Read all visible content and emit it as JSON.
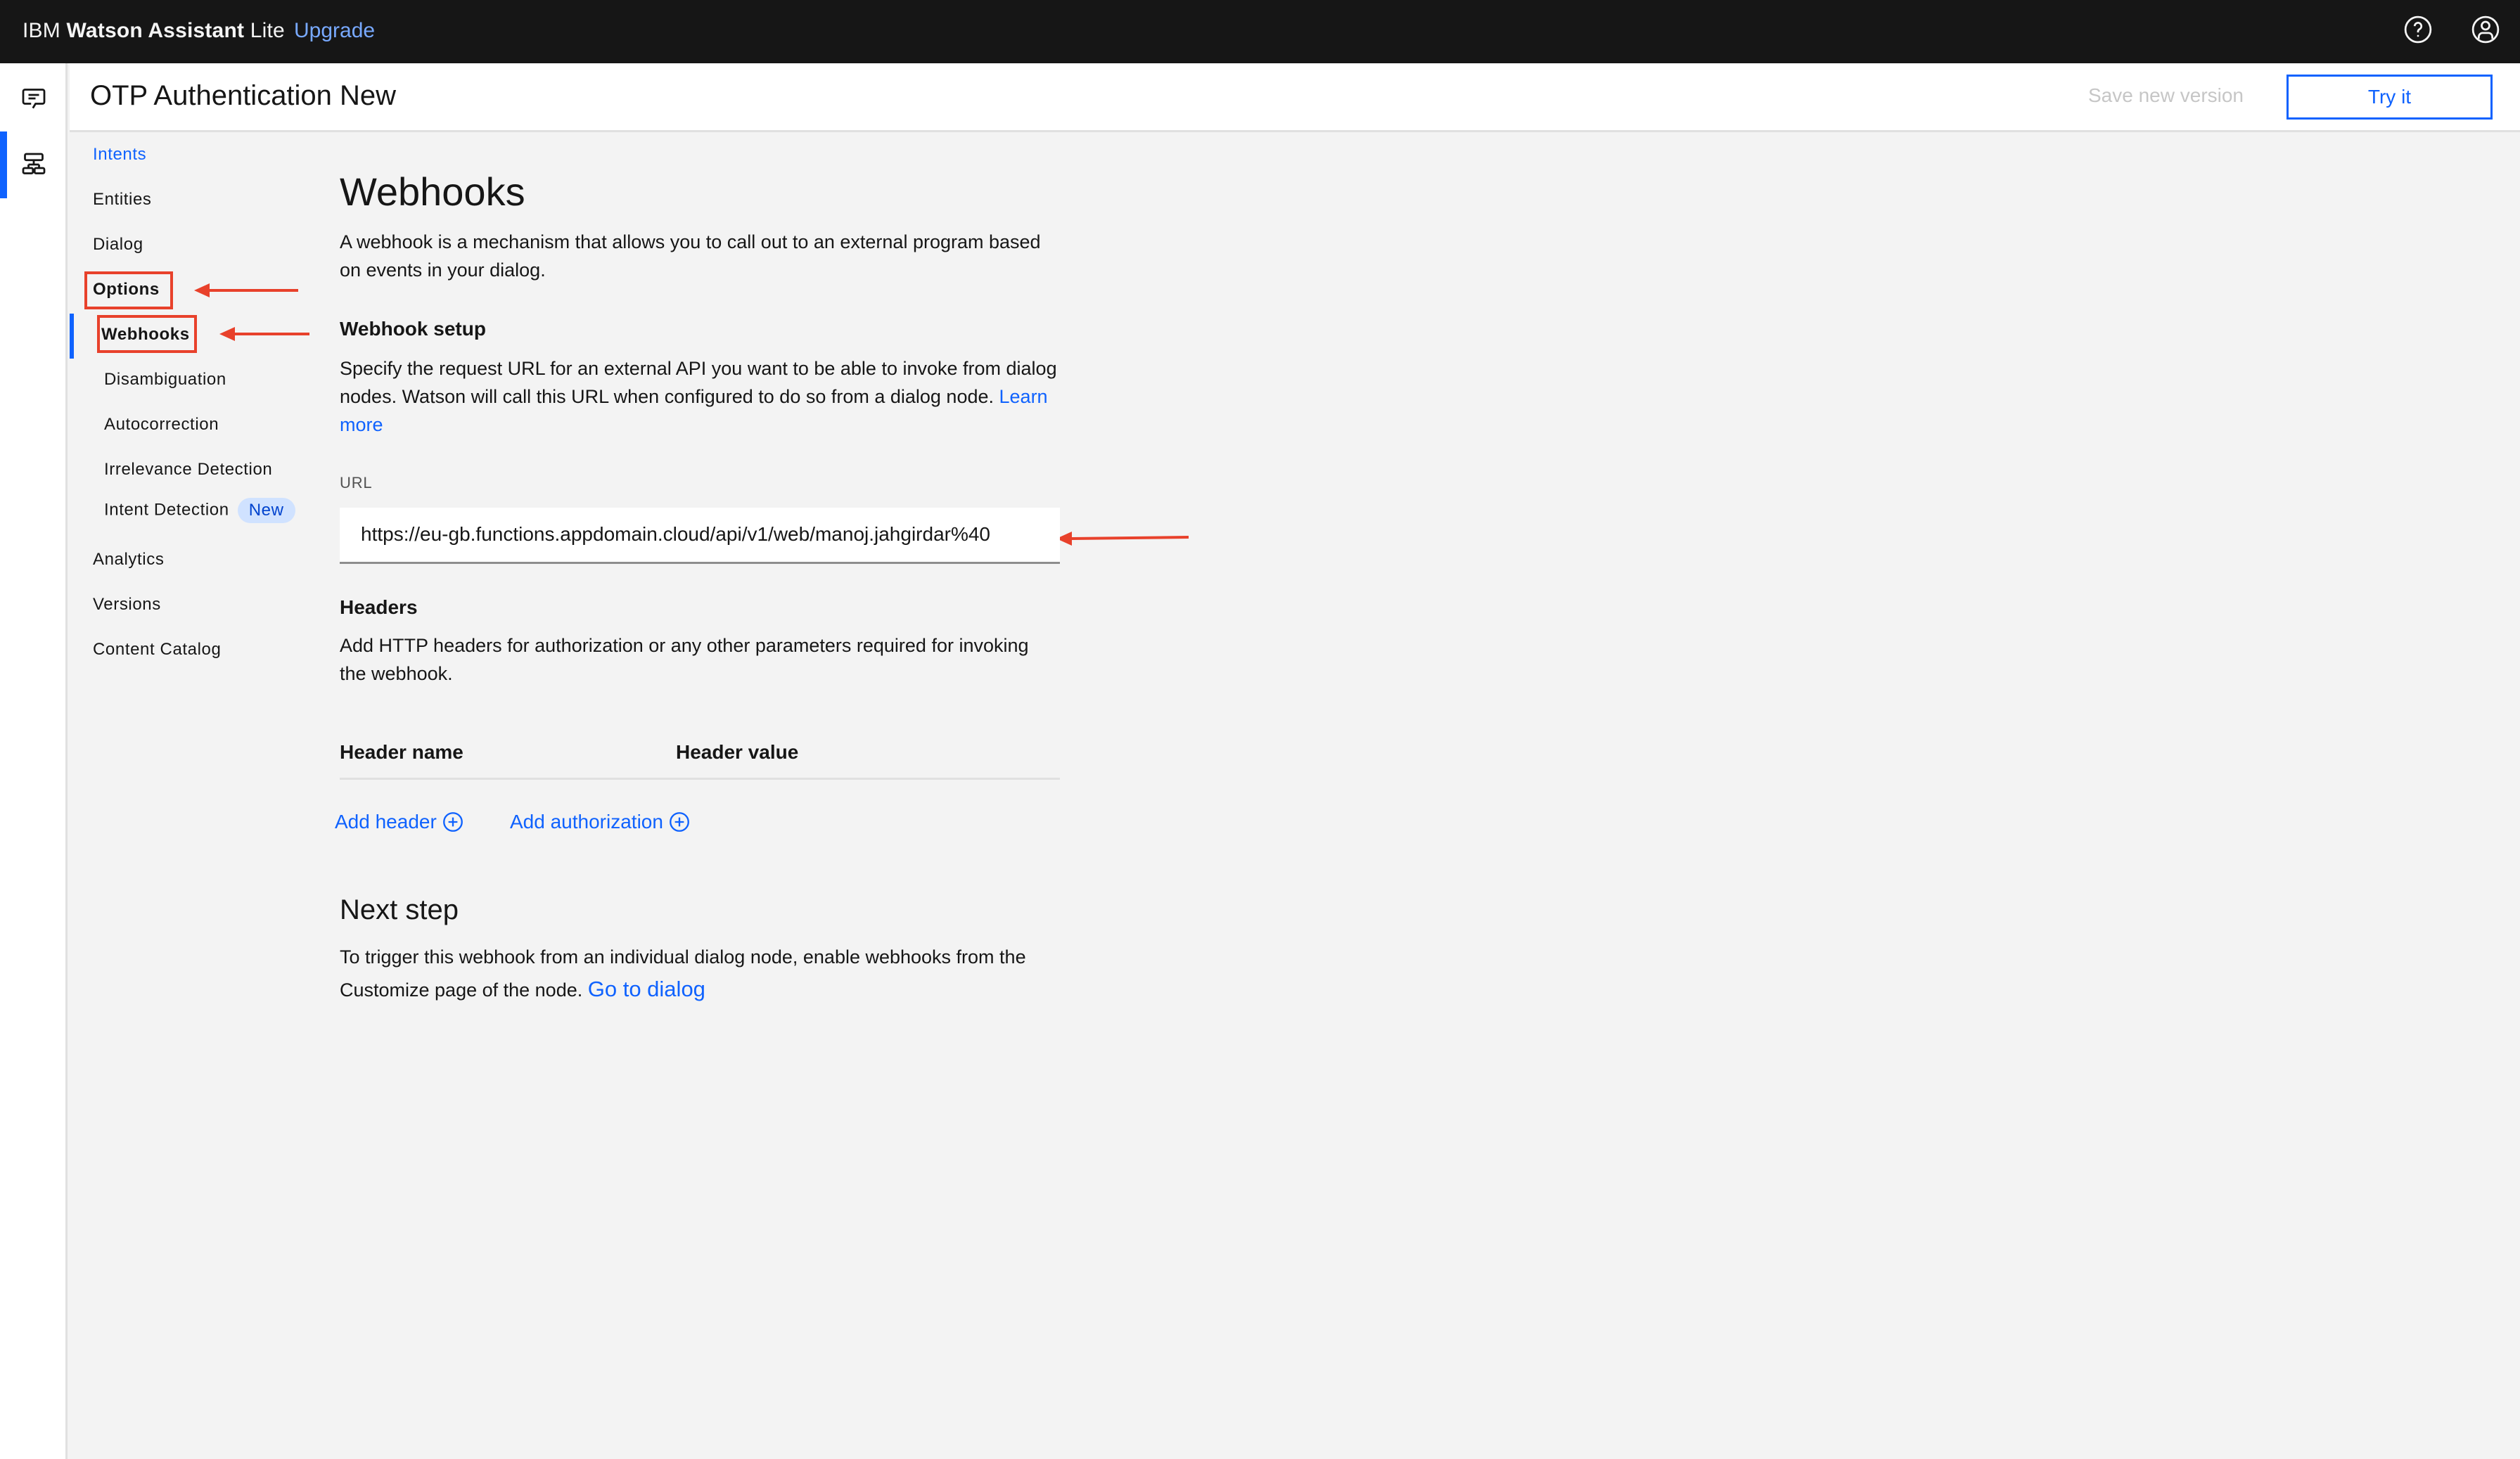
{
  "topbar": {
    "brand_prefix": "IBM",
    "brand_product": "Watson Assistant",
    "brand_plan": "Lite",
    "upgrade_label": "Upgrade",
    "icons": [
      "help-icon",
      "user-avatar-icon"
    ]
  },
  "rail": {
    "items": [
      {
        "icon": "chat-icon",
        "active": false
      },
      {
        "icon": "skills-tree-icon",
        "active": true
      }
    ]
  },
  "header": {
    "title": "OTP Authentication New",
    "save_label": "Save new version",
    "try_label": "Try it"
  },
  "subnav": {
    "items": [
      {
        "label": "Intents",
        "level": 0,
        "state": "link"
      },
      {
        "label": "Entities",
        "level": 0
      },
      {
        "label": "Dialog",
        "level": 0
      },
      {
        "label": "Options",
        "level": 0,
        "state": "bold",
        "annotated": true
      },
      {
        "label": "Webhooks",
        "level": 1,
        "state": "active",
        "annotated": true
      },
      {
        "label": "Disambiguation",
        "level": 1
      },
      {
        "label": "Autocorrection",
        "level": 1
      },
      {
        "label": "Irrelevance Detection",
        "level": 1
      },
      {
        "label": "Intent Detection",
        "level": 1,
        "badge": "New"
      },
      {
        "label": "Analytics",
        "level": 0
      },
      {
        "label": "Versions",
        "level": 0
      },
      {
        "label": "Content Catalog",
        "level": 0
      }
    ]
  },
  "main": {
    "title": "Webhooks",
    "intro": "A webhook is a mechanism that allows you to call out to an external program based on events in your dialog.",
    "setup": {
      "heading": "Webhook setup",
      "description": "Specify the request URL for an external API you want to be able to invoke from dialog nodes. Watson will call this URL when configured to do so from a dialog node.",
      "learn_more": "Learn more",
      "url_label": "URL",
      "url_value": "https://eu-gb.functions.appdomain.cloud/api/v1/web/manoj.jahgirdar%40"
    },
    "headers": {
      "heading": "Headers",
      "description": "Add HTTP headers for authorization or any other parameters required for invoking the webhook.",
      "columns": [
        "Header name",
        "Header value"
      ],
      "add_header": "Add header",
      "add_authorization": "Add authorization"
    },
    "next_step": {
      "heading": "Next step",
      "description": "To trigger this webhook from an individual dialog node, enable webhooks from the Customize page of the node.",
      "link": "Go to dialog"
    }
  },
  "colors": {
    "accent": "#0f62fe",
    "topbar_bg": "#161616",
    "annotation": "#e8412b",
    "badge_bg": "#d0e2ff"
  }
}
